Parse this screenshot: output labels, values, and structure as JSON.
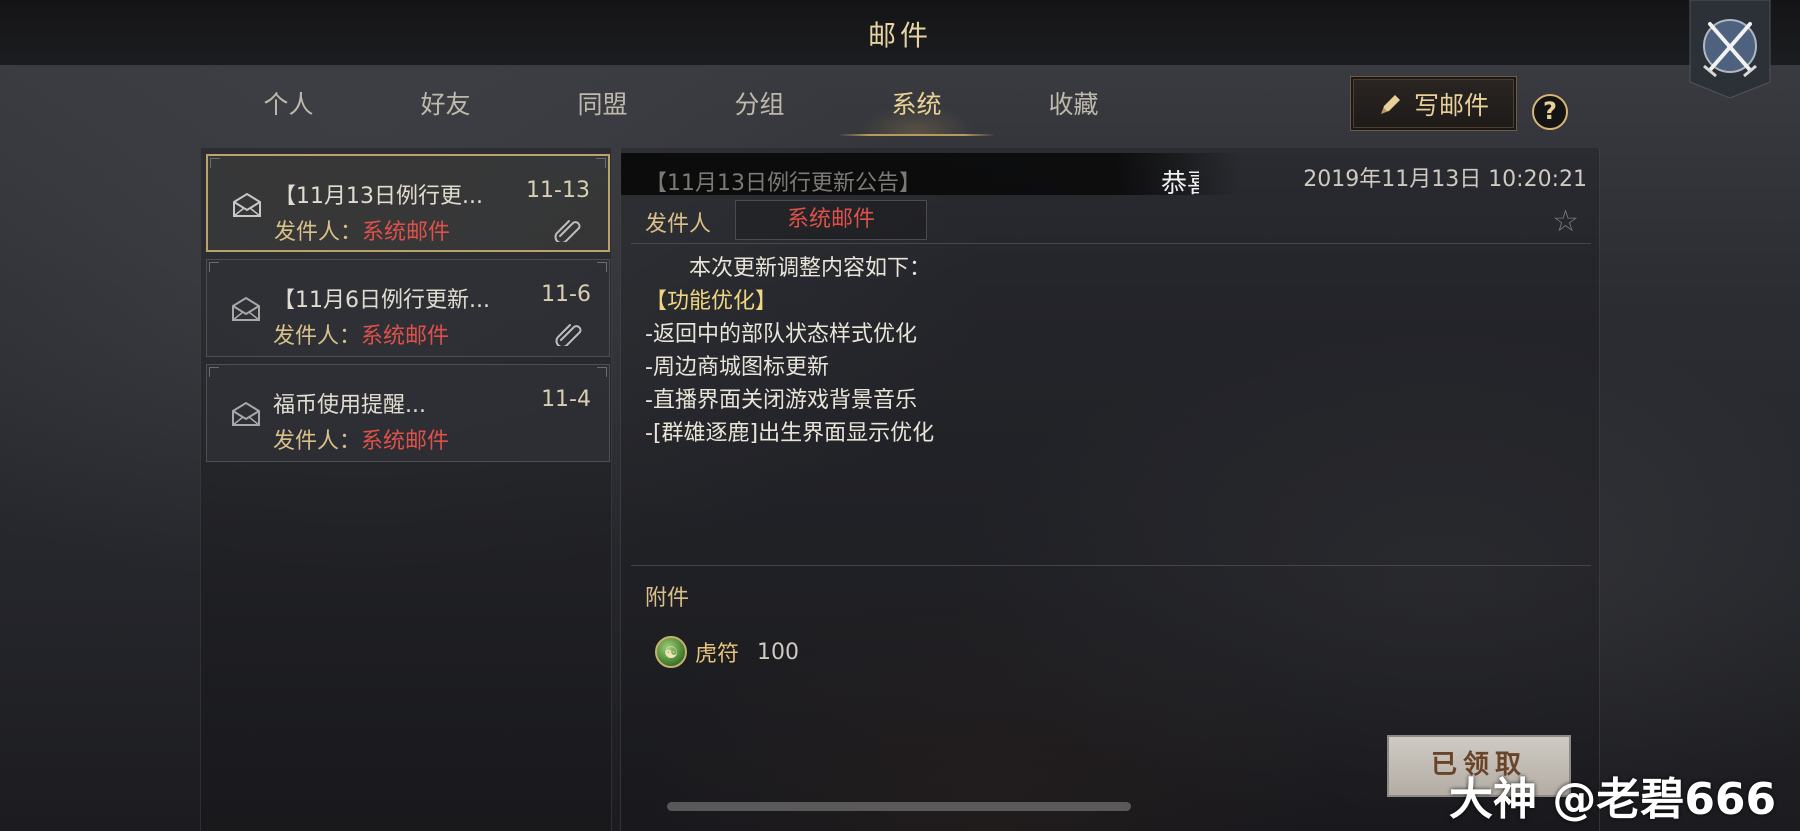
{
  "window": {
    "title": "邮件"
  },
  "tabs": [
    {
      "label": "个人",
      "active": false
    },
    {
      "label": "好友",
      "active": false
    },
    {
      "label": "同盟",
      "active": false
    },
    {
      "label": "分组",
      "active": false
    },
    {
      "label": "系统",
      "active": true
    },
    {
      "label": "收藏",
      "active": false
    }
  ],
  "toolbar": {
    "write_label": "写邮件",
    "help_label": "?"
  },
  "mail_list": [
    {
      "title": "【11月13日例行更...",
      "date": "11-13",
      "sender_label": "发件人：",
      "sender": "系统邮件",
      "has_attachment": true,
      "selected": true
    },
    {
      "title": "【11月6日例行更新...",
      "date": "11-6",
      "sender_label": "发件人：",
      "sender": "系统邮件",
      "has_attachment": true,
      "selected": false
    },
    {
      "title": "福币使用提醒...",
      "date": "11-4",
      "sender_label": "发件人：",
      "sender": "系统邮件",
      "has_attachment": false,
      "selected": false
    }
  ],
  "detail": {
    "subject": "【11月13日例行更新公告】",
    "ticker": "恭喜",
    "datetime": "2019年11月13日 10:20:21",
    "sender_label": "发件人",
    "sender": "系统邮件",
    "body": {
      "intro": "本次更新调整内容如下：",
      "section": "【功能优化】",
      "lines": [
        "-返回中的部队状态样式优化",
        "-周边商城图标更新",
        "-直播界面关闭游戏背景音乐",
        "-[群雄逐鹿]出生界面显示优化"
      ]
    },
    "attachment_label": "附件",
    "attachment": {
      "name": "虎符",
      "quantity": "100",
      "icon": "tiger-tally-icon"
    },
    "claimed_label": "已领取"
  },
  "watermark": "大神 @老碧666",
  "colors": {
    "gold": "#ecd293",
    "sender_red": "#e0504a",
    "section_yellow": "#f0d680"
  }
}
